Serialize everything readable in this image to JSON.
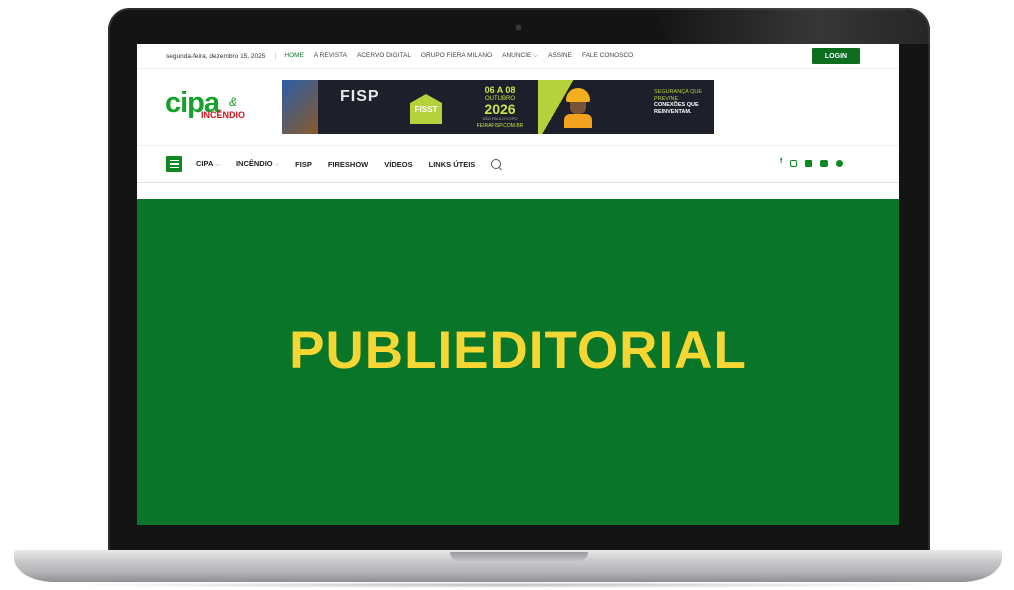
{
  "topbar": {
    "date": "segunda-feira, dezembro 15, 2025",
    "links": [
      {
        "label": "HOME",
        "active": true
      },
      {
        "label": "A REVISTA"
      },
      {
        "label": "ACERVO DIGITAL"
      },
      {
        "label": "GRUPO FIERA MILANO"
      },
      {
        "label": "ANUNCIE ⌵"
      },
      {
        "label": "ASSINE"
      },
      {
        "label": "FALE CONOSCO"
      }
    ],
    "login_label": "LOGIN"
  },
  "logo": {
    "cipa": "cipa",
    "amp": "&",
    "incendio": "INCÊNDIO"
  },
  "banner": {
    "fisp": "FISP",
    "fisst": "FISST",
    "date_range": "06 A 08",
    "month": "OUTUBRO",
    "year": "2026",
    "city": "SÃO PAULO EXPO",
    "site": "FEIRAFISP.COM.BR",
    "slogan_line1": "SEGURANÇA QUE PREVINE.",
    "slogan_line2": "CONEXÕES QUE REINVENTAM."
  },
  "nav": {
    "items": [
      {
        "label": "CIPA",
        "chevron": "⌵"
      },
      {
        "label": "INCÊNDIO",
        "chevron": "⌵"
      },
      {
        "label": "FISP"
      },
      {
        "label": "FIRESHOW"
      },
      {
        "label": "VÍDEOS"
      },
      {
        "label": "LINKS ÚTEIS"
      }
    ],
    "socials": [
      "facebook-icon",
      "instagram-icon",
      "linkedin-icon",
      "youtube-icon",
      "telegram-icon"
    ],
    "facebook_glyph": "f"
  },
  "hero": {
    "title": "PUBLIEDITORIAL"
  },
  "colors": {
    "brand_green": "#087528",
    "accent_yellow": "#f5d633",
    "login_green": "#0b6e1f"
  }
}
